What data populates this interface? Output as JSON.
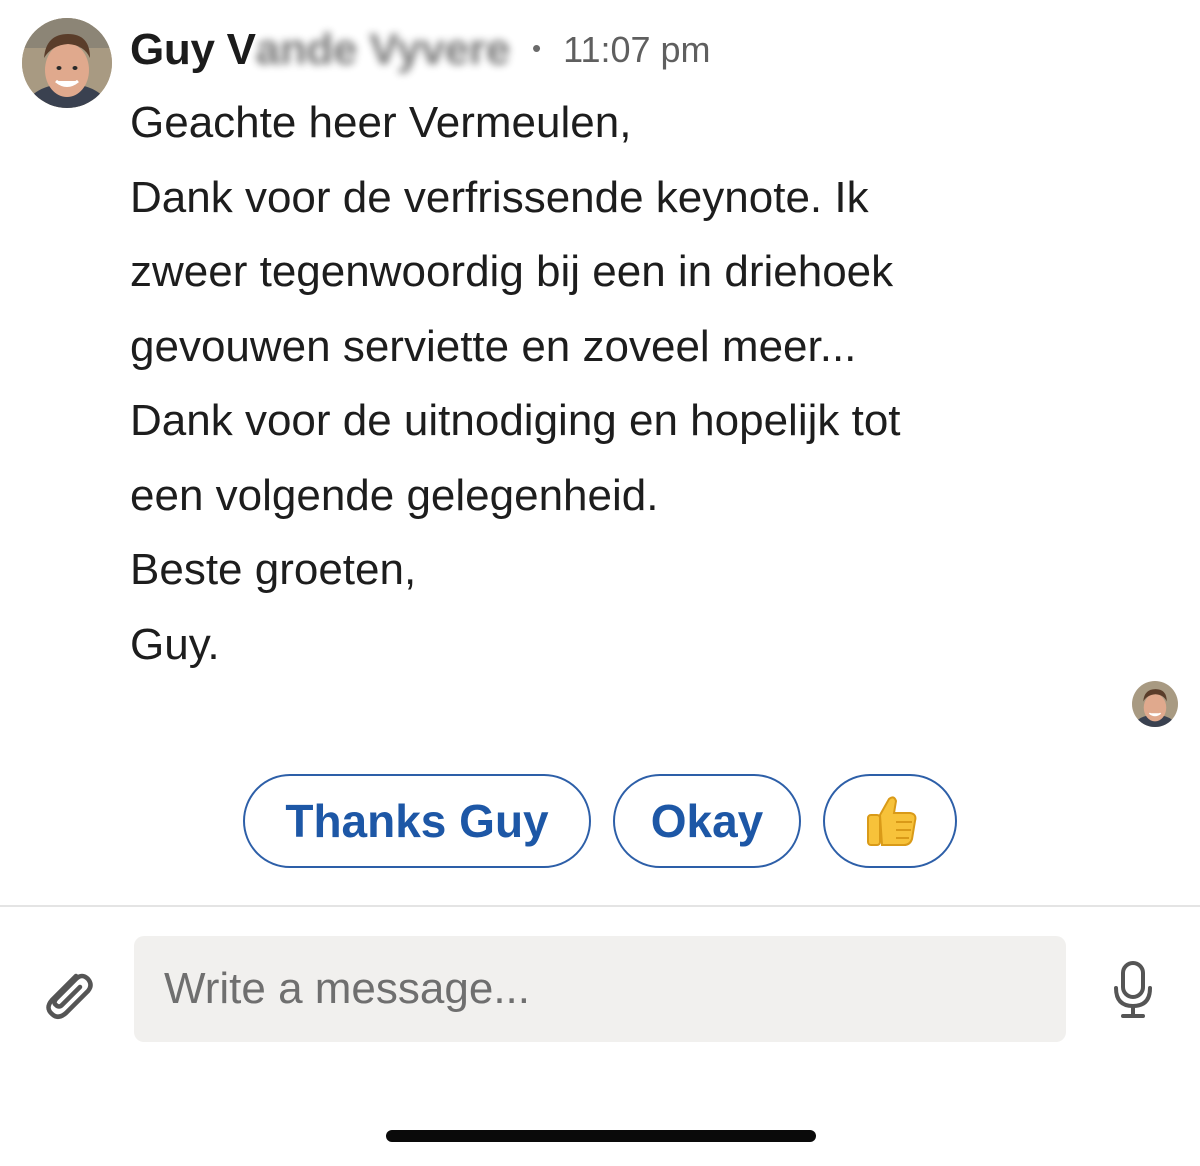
{
  "message": {
    "sender_visible": "Guy V",
    "sender_obscured": "ande Vyvere",
    "time": "11:07 pm",
    "separator": "•",
    "body_lines": [
      "Geachte heer Vermeulen,",
      "Dank voor de verfrissende keynote. Ik",
      "zweer tegenwoordig bij een in driehoek",
      "gevouwen serviette en zoveel meer...",
      "Dank voor de uitnodiging en hopelijk tot",
      "een volgende gelegenheid.",
      "Beste groeten,",
      "Guy."
    ]
  },
  "quick_replies": {
    "thanks": "Thanks Guy",
    "okay": "Okay",
    "thumb": "👍"
  },
  "composer": {
    "placeholder": "Write a message..."
  },
  "icons": {
    "attachment": "paperclip-icon",
    "microphone": "microphone-icon"
  },
  "colors": {
    "accent": "#1d57a6",
    "input_bg": "#f1f0ee"
  }
}
